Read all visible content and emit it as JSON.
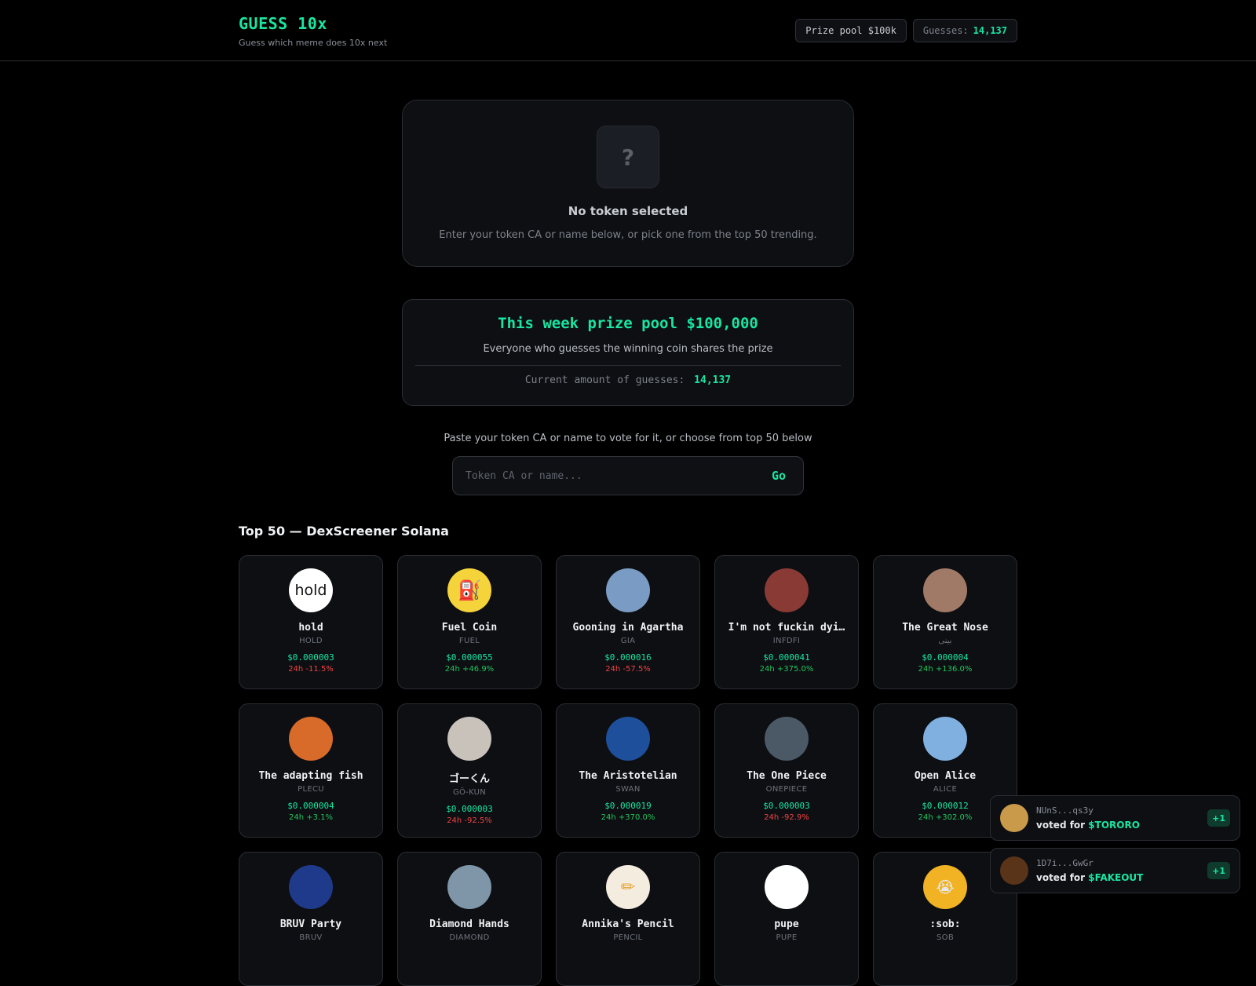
{
  "header": {
    "title": "GUESS 10x",
    "subtitle": "Guess which meme does 10x next",
    "prize_pill": "Prize pool $100k",
    "guesses_label": "Guesses:",
    "guesses_value": "14,137"
  },
  "selection": {
    "placeholder_icon": "?",
    "title": "No token selected",
    "description": "Enter your token CA or name below, or pick one from the top 50 trending."
  },
  "prize": {
    "title": "This week prize pool $100,000",
    "description": "Everyone who guesses the winning coin shares the prize",
    "count_label": "Current amount of guesses:",
    "count_value": "14,137"
  },
  "vote": {
    "label": "Paste your token CA or name to vote for it, or choose from top 50 below",
    "placeholder": "Token CA or name...",
    "go_label": "Go"
  },
  "list": {
    "title": "Top 50 — DexScreener Solana",
    "tokens": [
      {
        "name": "hold",
        "symbol": "HOLD",
        "price": "$0.000003",
        "change": "24h -11.5%",
        "dir": "down",
        "icon": "hold-logo",
        "avatar_text": "hold",
        "color": "#ffffff"
      },
      {
        "name": "Fuel Coin",
        "symbol": "FUEL",
        "price": "$0.000055",
        "change": "24h +46.9%",
        "dir": "up",
        "icon": "fuel-pump-icon",
        "avatar_text": "⛽",
        "color": "#f5d33a"
      },
      {
        "name": "Gooning in Agartha",
        "symbol": "GIA",
        "price": "$0.000016",
        "change": "24h -57.5%",
        "dir": "down",
        "icon": "portrait-icon",
        "avatar_text": "",
        "color": "#7a9cc4"
      },
      {
        "name": "I'm not fuckin dyi…",
        "symbol": "INFDFI",
        "price": "$0.000041",
        "change": "24h +375.0%",
        "dir": "up",
        "icon": "meme-image-icon",
        "avatar_text": "",
        "color": "#8a3a35"
      },
      {
        "name": "The Great Nose",
        "symbol": "بينى",
        "price": "$0.000004",
        "change": "24h +136.0%",
        "dir": "up",
        "icon": "face-icon",
        "avatar_text": "",
        "color": "#a07a66"
      },
      {
        "name": "The adapting fish",
        "symbol": "PLECU",
        "price": "$0.000004",
        "change": "24h +3.1%",
        "dir": "up",
        "icon": "fish-icon",
        "avatar_text": "",
        "color": "#d86a2a"
      },
      {
        "name": "ゴーくん",
        "symbol": "GŌ-KUN",
        "price": "$0.000003",
        "change": "24h -92.5%",
        "dir": "down",
        "icon": "polar-bear-icon",
        "avatar_text": "",
        "color": "#c8c2bb"
      },
      {
        "name": "The Aristotelian",
        "symbol": "SWAN",
        "price": "$0.000019",
        "change": "24h +370.0%",
        "dir": "up",
        "icon": "swan-icon",
        "avatar_text": "",
        "color": "#1d4f9a"
      },
      {
        "name": "The One Piece",
        "symbol": "ONEPIECE",
        "price": "$0.000003",
        "change": "24h -92.9%",
        "dir": "down",
        "icon": "diver-icon",
        "avatar_text": "",
        "color": "#4b5866"
      },
      {
        "name": "Open Alice",
        "symbol": "ALICE",
        "price": "$0.000012",
        "change": "24h +302.0%",
        "dir": "up",
        "icon": "anime-girl-icon",
        "avatar_text": "",
        "color": "#7fb0e0"
      },
      {
        "name": "BRUV Party",
        "symbol": "BRUV",
        "price": "",
        "change": "",
        "dir": "up",
        "icon": "union-jack-icon",
        "avatar_text": "",
        "color": "#1f3a8a"
      },
      {
        "name": "Diamond Hands",
        "symbol": "DIAMOND",
        "price": "",
        "change": "",
        "dir": "up",
        "icon": "diamond-hand-icon",
        "avatar_text": "",
        "color": "#7f95a8"
      },
      {
        "name": "Annika's Pencil",
        "symbol": "PENCIL",
        "price": "",
        "change": "",
        "dir": "up",
        "icon": "pencil-icon",
        "avatar_text": "✏",
        "color": "#f5ece0"
      },
      {
        "name": "pupe",
        "symbol": "PUPE",
        "price": "",
        "change": "",
        "dir": "up",
        "icon": "pepe-icon",
        "avatar_text": "",
        "color": "#ffffff"
      },
      {
        "name": ":sob:",
        "symbol": "SOB",
        "price": "",
        "change": "",
        "dir": "up",
        "icon": "crying-emoji-icon",
        "avatar_text": "😭",
        "color": "#f1b324"
      }
    ]
  },
  "toasts": [
    {
      "address": "NUnS...qs3y",
      "prefix": "voted for",
      "ticker": "$TORORO",
      "badge": "+1",
      "color": "#c89a4a"
    },
    {
      "address": "1D7i...GwGr",
      "prefix": "voted for",
      "ticker": "$FAKEOUT",
      "badge": "+1",
      "color": "#5a3418"
    }
  ],
  "colors": {
    "accent": "#19e6a1",
    "background": "#000000",
    "card": "#0d0f12",
    "up": "#22c55e",
    "down": "#ef4444"
  }
}
